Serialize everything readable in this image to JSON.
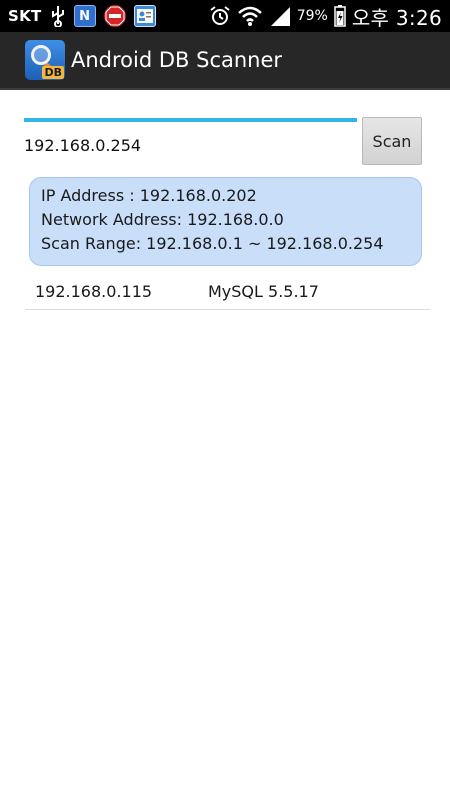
{
  "status_bar": {
    "carrier": "SKT",
    "battery_percent": "79%",
    "time": "오후 3:26",
    "notif_n_label": "N",
    "icons": [
      "usb-icon",
      "n-app-icon",
      "stop-app-icon",
      "contact-card-icon",
      "alarm-icon",
      "wifi-icon",
      "signal-icon",
      "battery-icon"
    ]
  },
  "action_bar": {
    "title": "Android DB Scanner",
    "icon_badge": "DB"
  },
  "scan_form": {
    "ip_value": "192.168.0.254",
    "scan_button": "Scan"
  },
  "info": {
    "ip_address": "IP Address : 192.168.0.202",
    "network_address": "Network Address: 192.168.0.0",
    "scan_range": "Scan Range: 192.168.0.1 ~ 192.168.0.254"
  },
  "results": [
    {
      "ip": "192.168.0.115",
      "db": "MySQL 5.5.17"
    }
  ],
  "colors": {
    "accent": "#34b5e5",
    "action_bar": "#272727",
    "info_box": "#c9def9"
  }
}
